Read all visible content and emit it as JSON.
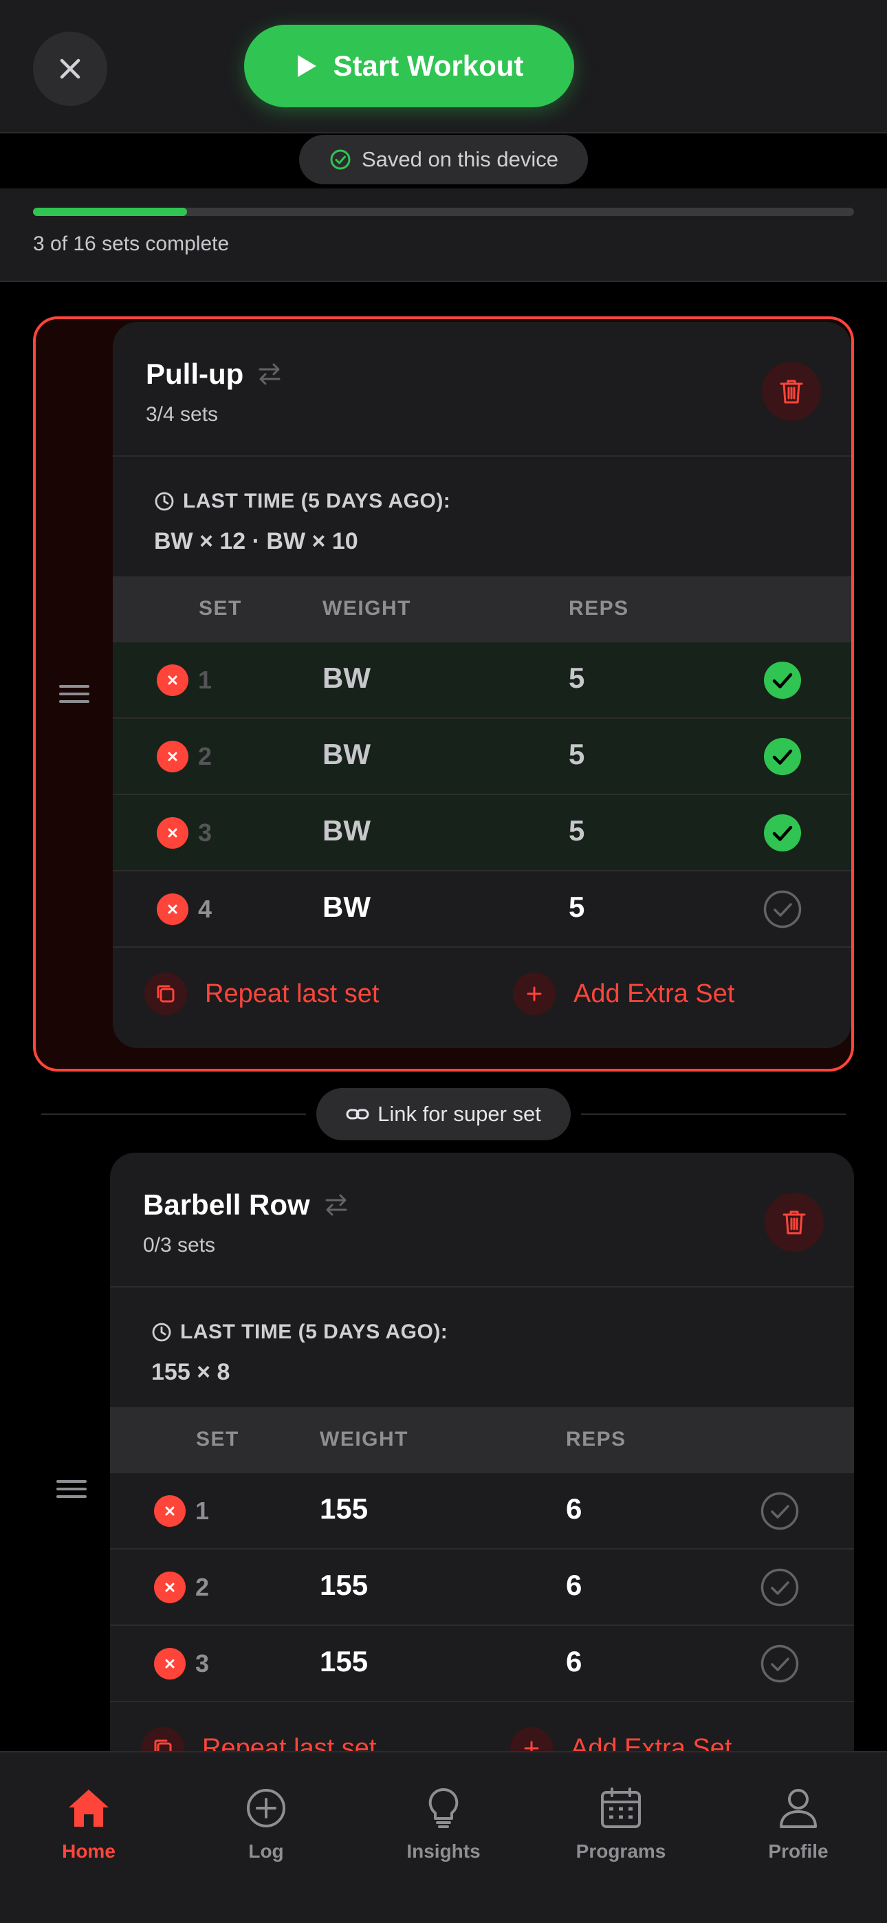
{
  "header": {
    "close_icon": "close-icon",
    "start_label": "Start Workout",
    "accent_green": "#30c452"
  },
  "saved": {
    "label": "Saved on this device",
    "icon": "check-circle-icon"
  },
  "progress": {
    "completed": 3,
    "total": 16,
    "fraction": 0.1875,
    "label": "3 of 16 sets complete"
  },
  "exercises": [
    {
      "name": "Pull-up",
      "sets_label": "3/4 sets",
      "last_time_label": "LAST TIME (5 DAYS AGO):",
      "last_time_value": "BW × 12  ·  BW × 10",
      "columns": {
        "set": "SET",
        "weight": "WEIGHT",
        "reps": "REPS"
      },
      "rows": [
        {
          "set": "1",
          "weight": "BW",
          "reps": "5",
          "done": true
        },
        {
          "set": "2",
          "weight": "BW",
          "reps": "5",
          "done": true
        },
        {
          "set": "3",
          "weight": "BW",
          "reps": "5",
          "done": true
        },
        {
          "set": "4",
          "weight": "BW",
          "reps": "5",
          "done": false
        }
      ],
      "repeat_label": "Repeat last set",
      "add_label": "Add Extra Set"
    },
    {
      "name": "Barbell Row",
      "sets_label": "0/3 sets",
      "last_time_label": "LAST TIME (5 DAYS AGO):",
      "last_time_value": "155 × 8",
      "columns": {
        "set": "SET",
        "weight": "WEIGHT",
        "reps": "REPS"
      },
      "rows": [
        {
          "set": "1",
          "weight": "155",
          "reps": "6",
          "done": false
        },
        {
          "set": "2",
          "weight": "155",
          "reps": "6",
          "done": false
        },
        {
          "set": "3",
          "weight": "155",
          "reps": "6",
          "done": false
        }
      ],
      "repeat_label": "Repeat last set",
      "add_label": "Add Extra Set"
    }
  ],
  "superset": {
    "label": "Link for super set",
    "icon": "link-icon"
  },
  "nav": {
    "items": [
      {
        "label": "Home",
        "icon": "home-icon",
        "active": true
      },
      {
        "label": "Log",
        "icon": "plus-circle-icon",
        "active": false
      },
      {
        "label": "Insights",
        "icon": "lightbulb-icon",
        "active": false
      },
      {
        "label": "Programs",
        "icon": "calendar-icon",
        "active": false
      },
      {
        "label": "Profile",
        "icon": "user-icon",
        "active": false
      }
    ]
  },
  "colors": {
    "accent_red": "#ff453a",
    "background": "#000000",
    "card": "#1c1c1e"
  }
}
